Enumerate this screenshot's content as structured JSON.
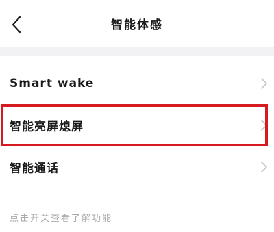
{
  "header": {
    "title": "智能体感",
    "back_icon": "chevron-left-icon"
  },
  "settings": {
    "items": [
      {
        "label": "Smart wake",
        "icon": "chevron-right-icon"
      },
      {
        "label": "智能亮屏熄屏",
        "icon": "chevron-right-icon",
        "highlighted": true
      },
      {
        "label": "智能通话",
        "icon": "chevron-right-icon"
      }
    ]
  },
  "hint": {
    "text": "点击开关查看了解功能"
  },
  "colors": {
    "background": "#ffffff",
    "band": "#f2f2f4",
    "text": "#1a1a1a",
    "hint_text": "#a8a8a8",
    "chevron": "#c4c4c4",
    "highlight_border": "#d71920"
  }
}
